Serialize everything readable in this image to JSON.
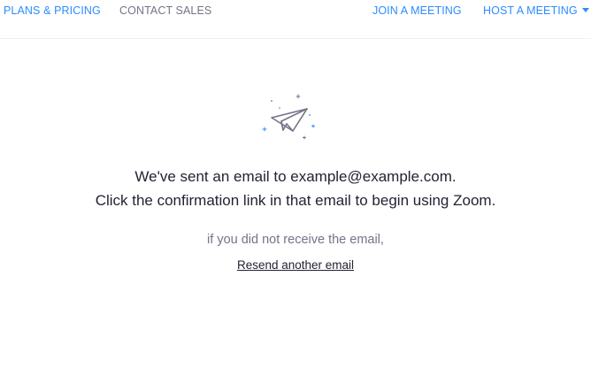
{
  "nav": {
    "plans_pricing": "PLANS & PRICING",
    "contact_sales": "CONTACT SALES",
    "join_meeting": "JOIN A MEETING",
    "host_meeting": "HOST A MEETING"
  },
  "confirmation": {
    "line1_prefix": "We've sent an email to ",
    "email": "example@example.com",
    "line1_suffix": ".",
    "line2": "Click the confirmation link in that email to begin using Zoom.",
    "not_received": "if you did not receive the email,",
    "resend_link": "Resend another email"
  },
  "icons": {
    "hero": "paper-plane-icon",
    "host_menu_caret": "caret-down-icon"
  },
  "colors": {
    "accent": "#2d8cff",
    "text_dark": "#232333",
    "text_muted": "#747487"
  }
}
